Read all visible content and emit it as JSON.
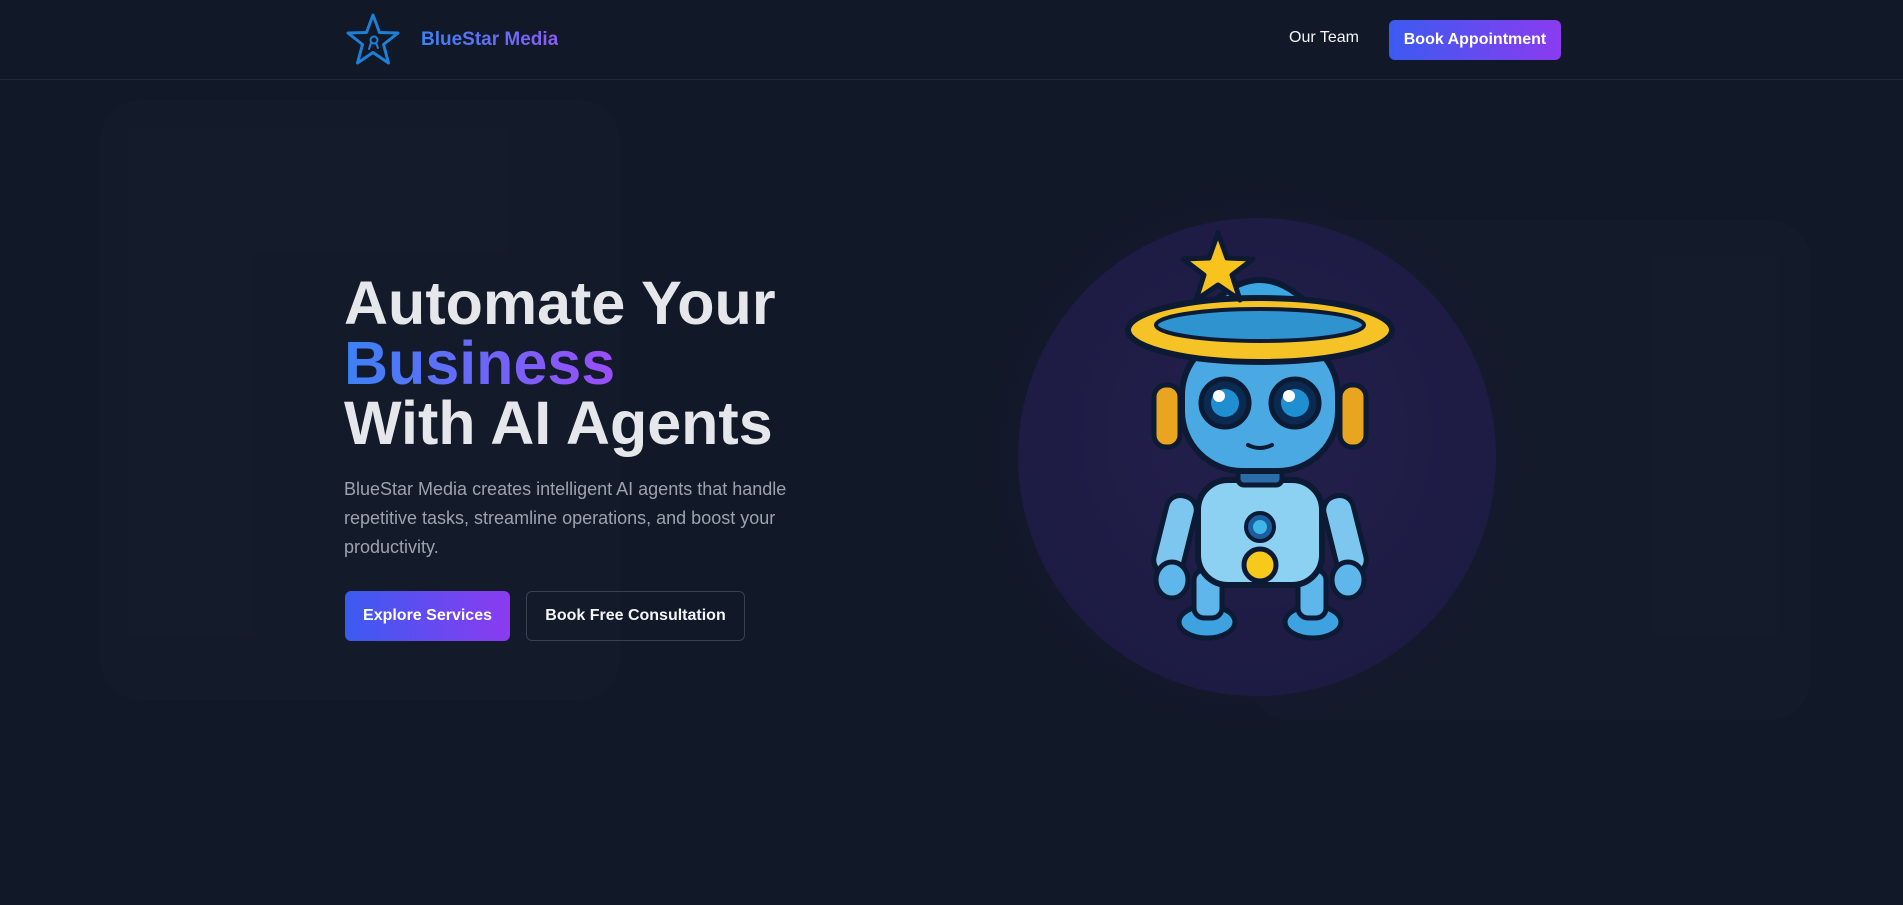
{
  "nav": {
    "brand_name": "BlueStar Media",
    "links": [
      {
        "label": "Our Team"
      }
    ],
    "cta_label": "Book Appointment"
  },
  "hero": {
    "title_line1": "Automate Your",
    "title_accent": "Business",
    "title_line3": "With AI Agents",
    "description": "BlueStar Media creates intelligent AI agents that handle repetitive tasks, streamline operations, and boost your productivity.",
    "primary_button": "Explore Services",
    "secondary_button": "Book Free Consultation"
  },
  "colors": {
    "background": "#111827",
    "accent_start": "#3b5bf0",
    "accent_end": "#8b3bf0",
    "muted_text": "#9ca3af"
  },
  "icons": {
    "brand_logo": "star-logo-icon",
    "hero_illustration": "robot-mascot"
  }
}
